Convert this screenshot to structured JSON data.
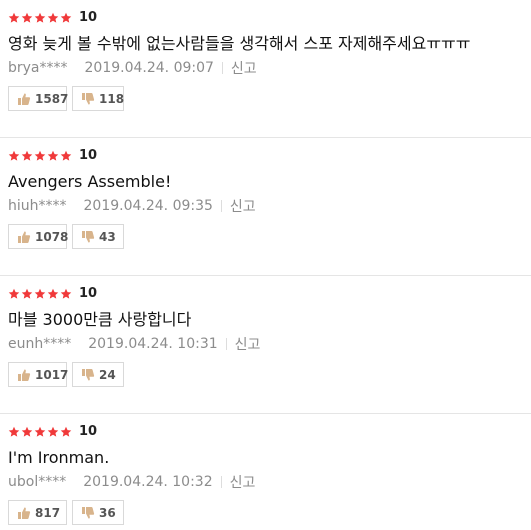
{
  "colors": {
    "star": "#f0393a",
    "text": "#111111",
    "meta": "#8c8c8c",
    "divider": "#e5e5e5",
    "thumb": "#d8b48c"
  },
  "icons": {
    "star": "star-icon",
    "like": "thumbs-up-icon",
    "dislike": "thumbs-down-icon"
  },
  "reviews": [
    {
      "stars": 5,
      "score": "10",
      "text": "영화 늦게 볼 수밖에 없는사람들을 생각해서 스포 자제해주세요ㅠㅠㅠ",
      "author": "brya****",
      "date": "2019.04.24. 09:07",
      "report_label": "신고",
      "likes": "1587",
      "dislikes": "118"
    },
    {
      "stars": 5,
      "score": "10",
      "text": "Avengers Assemble!",
      "author": "hiuh****",
      "date": "2019.04.24. 09:35",
      "report_label": "신고",
      "likes": "1078",
      "dislikes": "43"
    },
    {
      "stars": 5,
      "score": "10",
      "text": "마블 3000만큼 사랑합니다",
      "author": "eunh****",
      "date": "2019.04.24. 10:31",
      "report_label": "신고",
      "likes": "1017",
      "dislikes": "24"
    },
    {
      "stars": 5,
      "score": "10",
      "text": "I'm Ironman.",
      "author": "ubol****",
      "date": "2019.04.24. 10:32",
      "report_label": "신고",
      "likes": "817",
      "dislikes": "36"
    }
  ]
}
